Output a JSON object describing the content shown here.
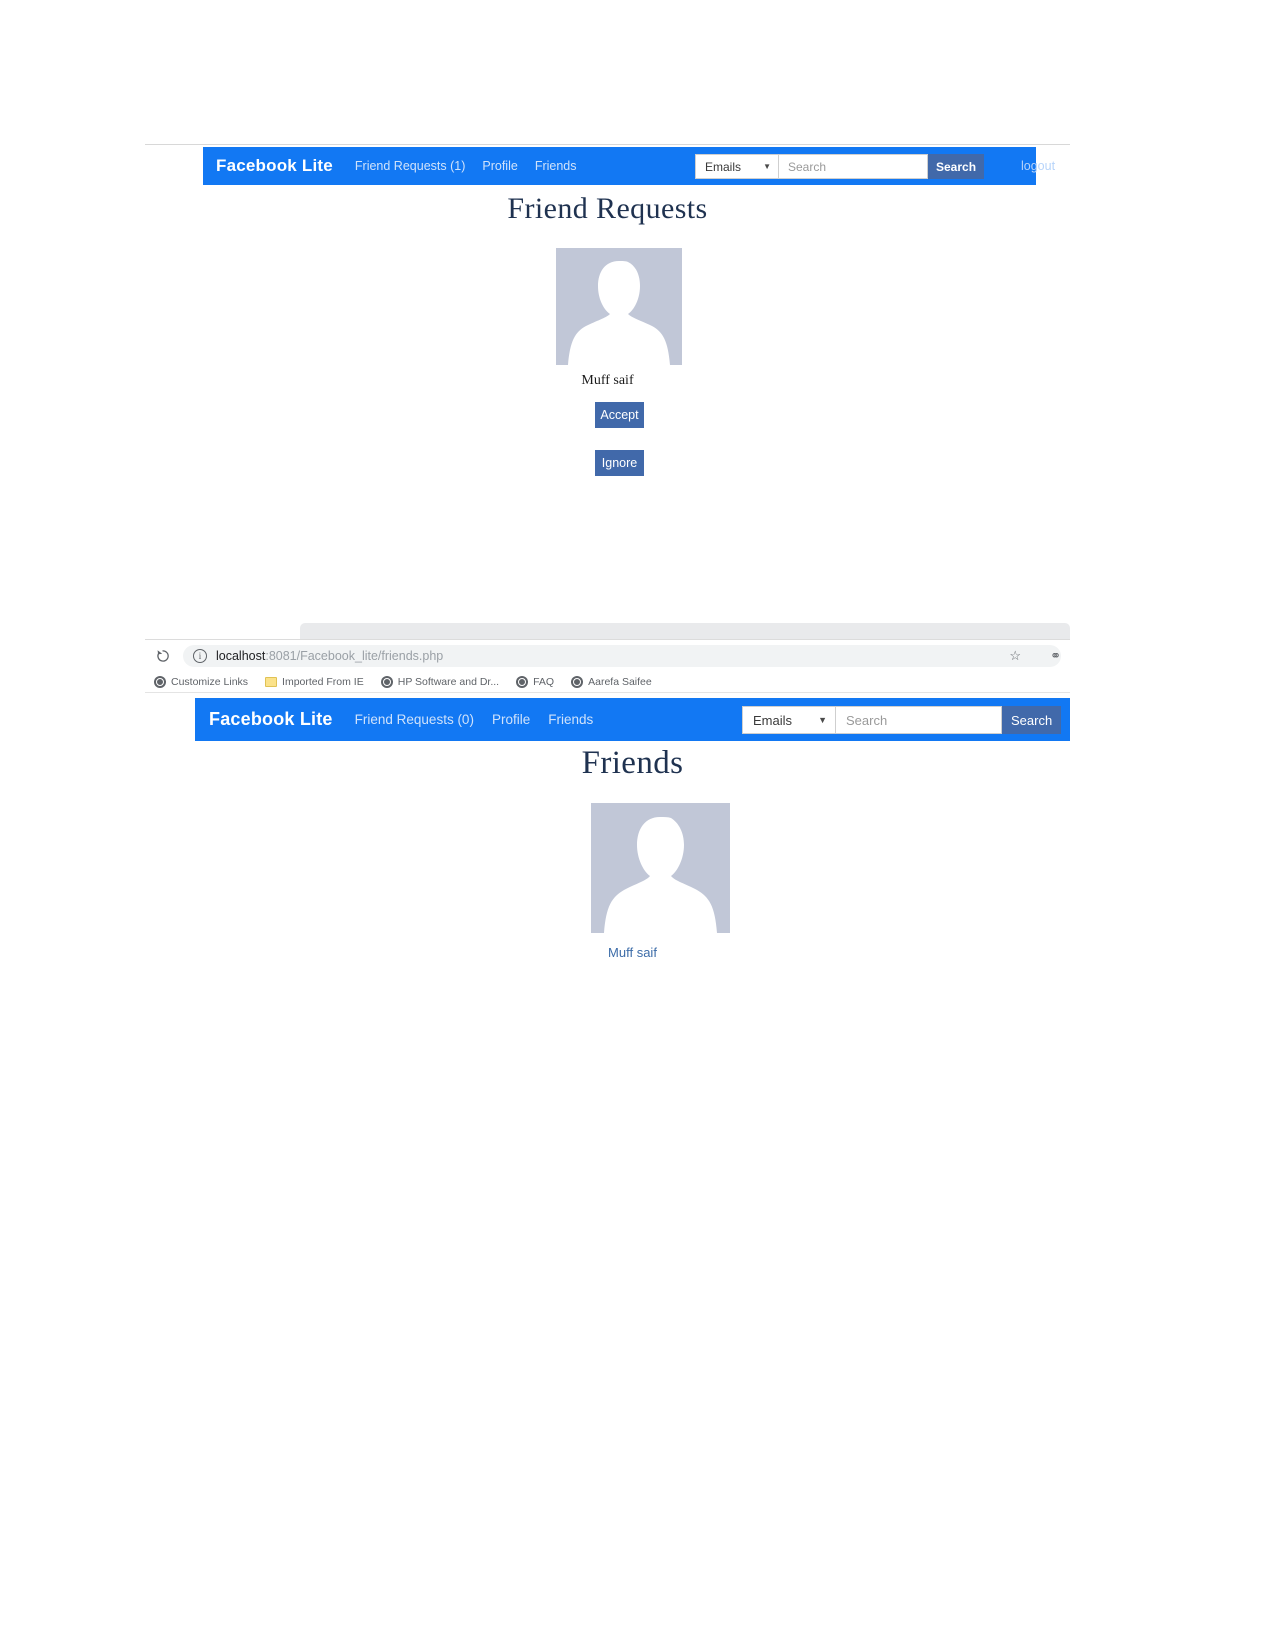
{
  "shot1": {
    "navbar": {
      "brand": "Facebook Lite",
      "links": [
        {
          "label": "Friend Requests (1)"
        },
        {
          "label": "Profile"
        },
        {
          "label": "Friends"
        }
      ],
      "search_category": "Emails",
      "search_placeholder": "Search",
      "search_value": "",
      "search_button": "Search",
      "logout": "logout"
    },
    "page_title": "Friend Requests",
    "request": {
      "name": "Muff saif",
      "accept_label": "Accept",
      "ignore_label": "Ignore"
    }
  },
  "shot2": {
    "browser": {
      "reload_icon": "reload-icon",
      "info_icon": "info-icon",
      "url_host": "localhost",
      "url_path": ":8081/Facebook_lite/friends.php",
      "star_icon": "star-icon",
      "profile_icon": "profile-icon",
      "bookmarks": [
        {
          "label": "Customize Links",
          "icon": "globe-icon"
        },
        {
          "label": "Imported From IE",
          "icon": "folder-icon"
        },
        {
          "label": "HP Software and Dr...",
          "icon": "globe-icon"
        },
        {
          "label": "FAQ",
          "icon": "globe-icon"
        },
        {
          "label": "Aarefa Saifee",
          "icon": "globe-icon"
        }
      ]
    },
    "navbar": {
      "brand": "Facebook Lite",
      "links": [
        {
          "label": "Friend Requests (0)"
        },
        {
          "label": "Profile"
        },
        {
          "label": "Friends"
        }
      ],
      "search_category": "Emails",
      "search_placeholder": "Search",
      "search_value": "",
      "search_button": "Search"
    },
    "page_title": "Friends",
    "friend": {
      "name": "Muff saif"
    }
  },
  "colors": {
    "navbar_blue": "#1278f3",
    "button_blue": "#4169aa",
    "heading_navy": "#1f3250",
    "avatar_bg": "#c1c7d7",
    "link_blue": "#3c6ca8"
  }
}
